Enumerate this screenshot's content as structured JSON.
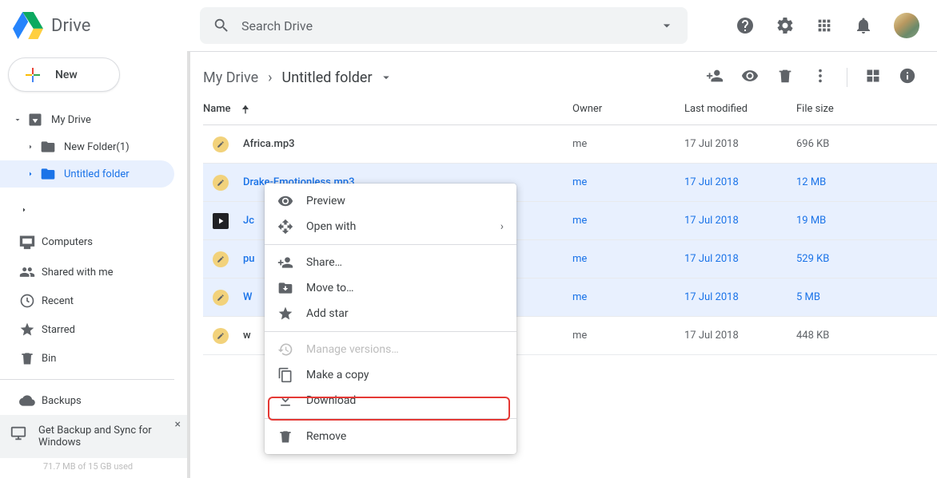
{
  "app_title": "Drive",
  "search": {
    "placeholder": "Search Drive"
  },
  "new_button": "New",
  "tree": {
    "root": "My Drive",
    "children": [
      {
        "label": "New Folder(1)"
      },
      {
        "label": "Untitled folder",
        "selected": true
      }
    ]
  },
  "nav": {
    "computers": "Computers",
    "shared": "Shared with me",
    "recent": "Recent",
    "starred": "Starred",
    "bin": "Bin",
    "backups": "Backups"
  },
  "promo": {
    "text": "Get Backup and Sync for Windows"
  },
  "storage_text": "71.7 MB of 15 GB used",
  "breadcrumb": {
    "parent": "My Drive",
    "current": "Untitled folder"
  },
  "columns": {
    "name": "Name",
    "owner": "Owner",
    "modified": "Last modified",
    "size": "File size"
  },
  "files": [
    {
      "name": "Africa.mp3",
      "owner": "me",
      "modified": "17 Jul 2018",
      "size": "696 KB",
      "icon": "audio",
      "selected": false
    },
    {
      "name": "Drake-Emotionless.mp3",
      "owner": "me",
      "modified": "17 Jul 2018",
      "size": "12 MB",
      "icon": "audio",
      "selected": true
    },
    {
      "name": "Jc",
      "owner": "me",
      "modified": "17 Jul 2018",
      "size": "19 MB",
      "icon": "video",
      "selected": true
    },
    {
      "name": "pu",
      "owner": "me",
      "modified": "17 Jul 2018",
      "size": "529 KB",
      "icon": "audio",
      "selected": true
    },
    {
      "name": "W",
      "owner": "me",
      "modified": "17 Jul 2018",
      "size": "5 MB",
      "icon": "audio",
      "selected": true
    },
    {
      "name": "w",
      "owner": "me",
      "modified": "17 Jul 2018",
      "size": "448 KB",
      "icon": "audio",
      "selected": false
    }
  ],
  "context_menu": {
    "preview": "Preview",
    "open_with": "Open with",
    "share": "Share…",
    "move_to": "Move to…",
    "add_star": "Add star",
    "manage_versions": "Manage versions…",
    "make_copy": "Make a copy",
    "download": "Download",
    "remove": "Remove"
  }
}
